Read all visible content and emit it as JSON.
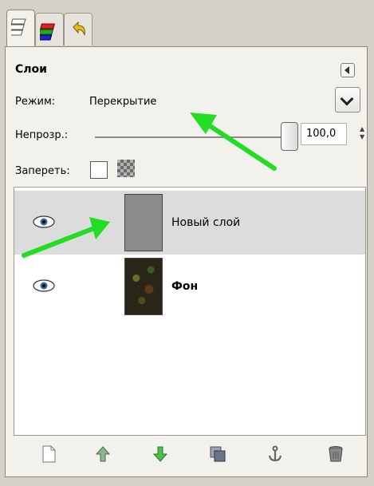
{
  "tabs": [
    {
      "icon": "layers-tab-icon"
    },
    {
      "icon": "channels-tab-icon"
    },
    {
      "icon": "undo-history-tab-icon"
    }
  ],
  "panel": {
    "title": "Слои"
  },
  "mode": {
    "label": "Режим:",
    "value": "Перекрытие"
  },
  "opacity": {
    "label": "Непрозр.:",
    "value": "100,0",
    "level": 100
  },
  "lock": {
    "label": "Запереть:"
  },
  "layers": [
    {
      "name": "Новый слой",
      "visible": true,
      "selected": true,
      "bold": false
    },
    {
      "name": "Фон",
      "visible": true,
      "selected": false,
      "bold": true
    }
  ],
  "toolbar": [
    "new-layer-icon",
    "raise-layer-icon",
    "lower-layer-icon",
    "duplicate-layer-icon",
    "anchor-layer-icon",
    "delete-layer-icon"
  ],
  "colors": {
    "annotation_arrow": "#22dd22",
    "selected_row": "#dcdcdc"
  }
}
